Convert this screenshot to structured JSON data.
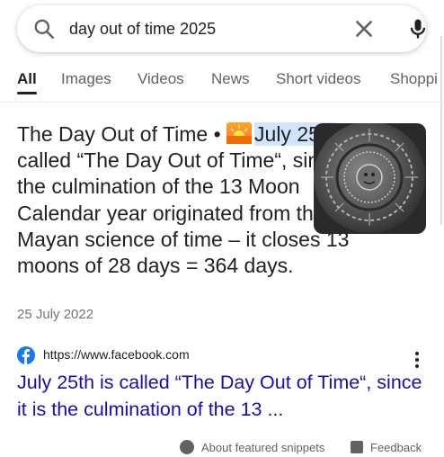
{
  "search": {
    "query": "day out of time 2025"
  },
  "tabs": [
    {
      "label": "All"
    },
    {
      "label": "Images"
    },
    {
      "label": "Videos"
    },
    {
      "label": "News"
    },
    {
      "label": "Short videos"
    },
    {
      "label": "Shoppi"
    }
  ],
  "snippet": {
    "lead": "The Day Out of Time • ",
    "highlight": "July 25th",
    "rest": " is called “The Day Out of Time“, since it is the culmination of the 13 Moon Calendar year originated from the Mayan science of time – it closes 13 moons of 28 days = 364 days.",
    "date": "25 July 2022"
  },
  "source": {
    "url": "https://www.facebook.com",
    "title": "July 25th is called “The Day Out of Time“, since it is the culmination of the 13 ..."
  },
  "footer": {
    "about": "About featured snippets",
    "feedback": "Feedback"
  },
  "colors": {
    "link": "#1a0dab",
    "highlight": "#d2e3fc",
    "facebook": "#1877f2"
  }
}
